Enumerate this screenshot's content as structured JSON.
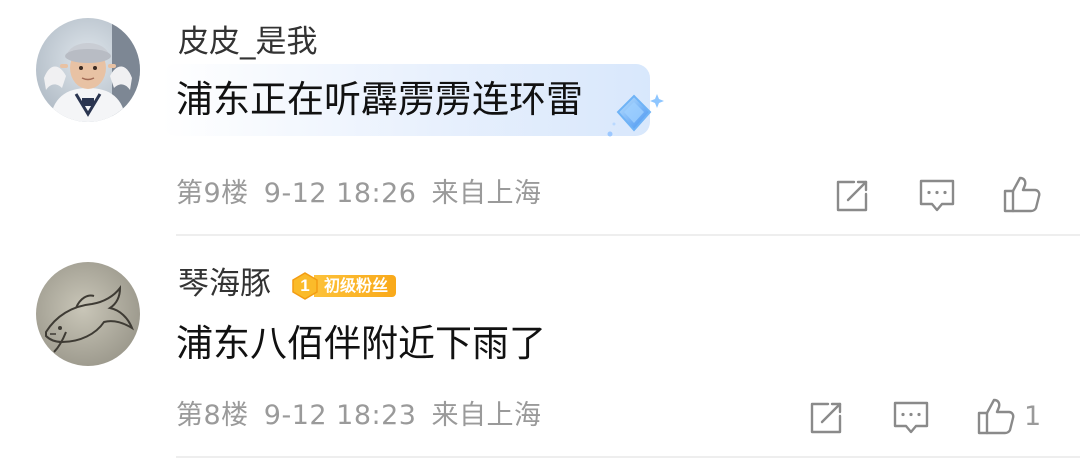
{
  "comments": [
    {
      "username": "皮皮_是我",
      "content": "浦东正在听霹雳雳连环雷",
      "floor": "第9楼",
      "date": "9-12 18:26",
      "location": "来自上海",
      "likes": ""
    },
    {
      "username": "琴海豚",
      "badge": {
        "level": "1",
        "label": "初级粉丝"
      },
      "content": "浦东八佰伴附近下雨了",
      "floor": "第8楼",
      "date": "9-12 18:23",
      "location": "来自上海",
      "likes": "1"
    }
  ],
  "icons": {
    "share": "share-icon",
    "reply": "comment-icon",
    "like": "thumbs-up-icon",
    "decoration": "diamond-sparkle-icon"
  },
  "colors": {
    "meta_text": "#9a9a9a",
    "badge": "#f9a91a",
    "bubble": "#dceafc",
    "diamond": "#5aa6f5"
  }
}
